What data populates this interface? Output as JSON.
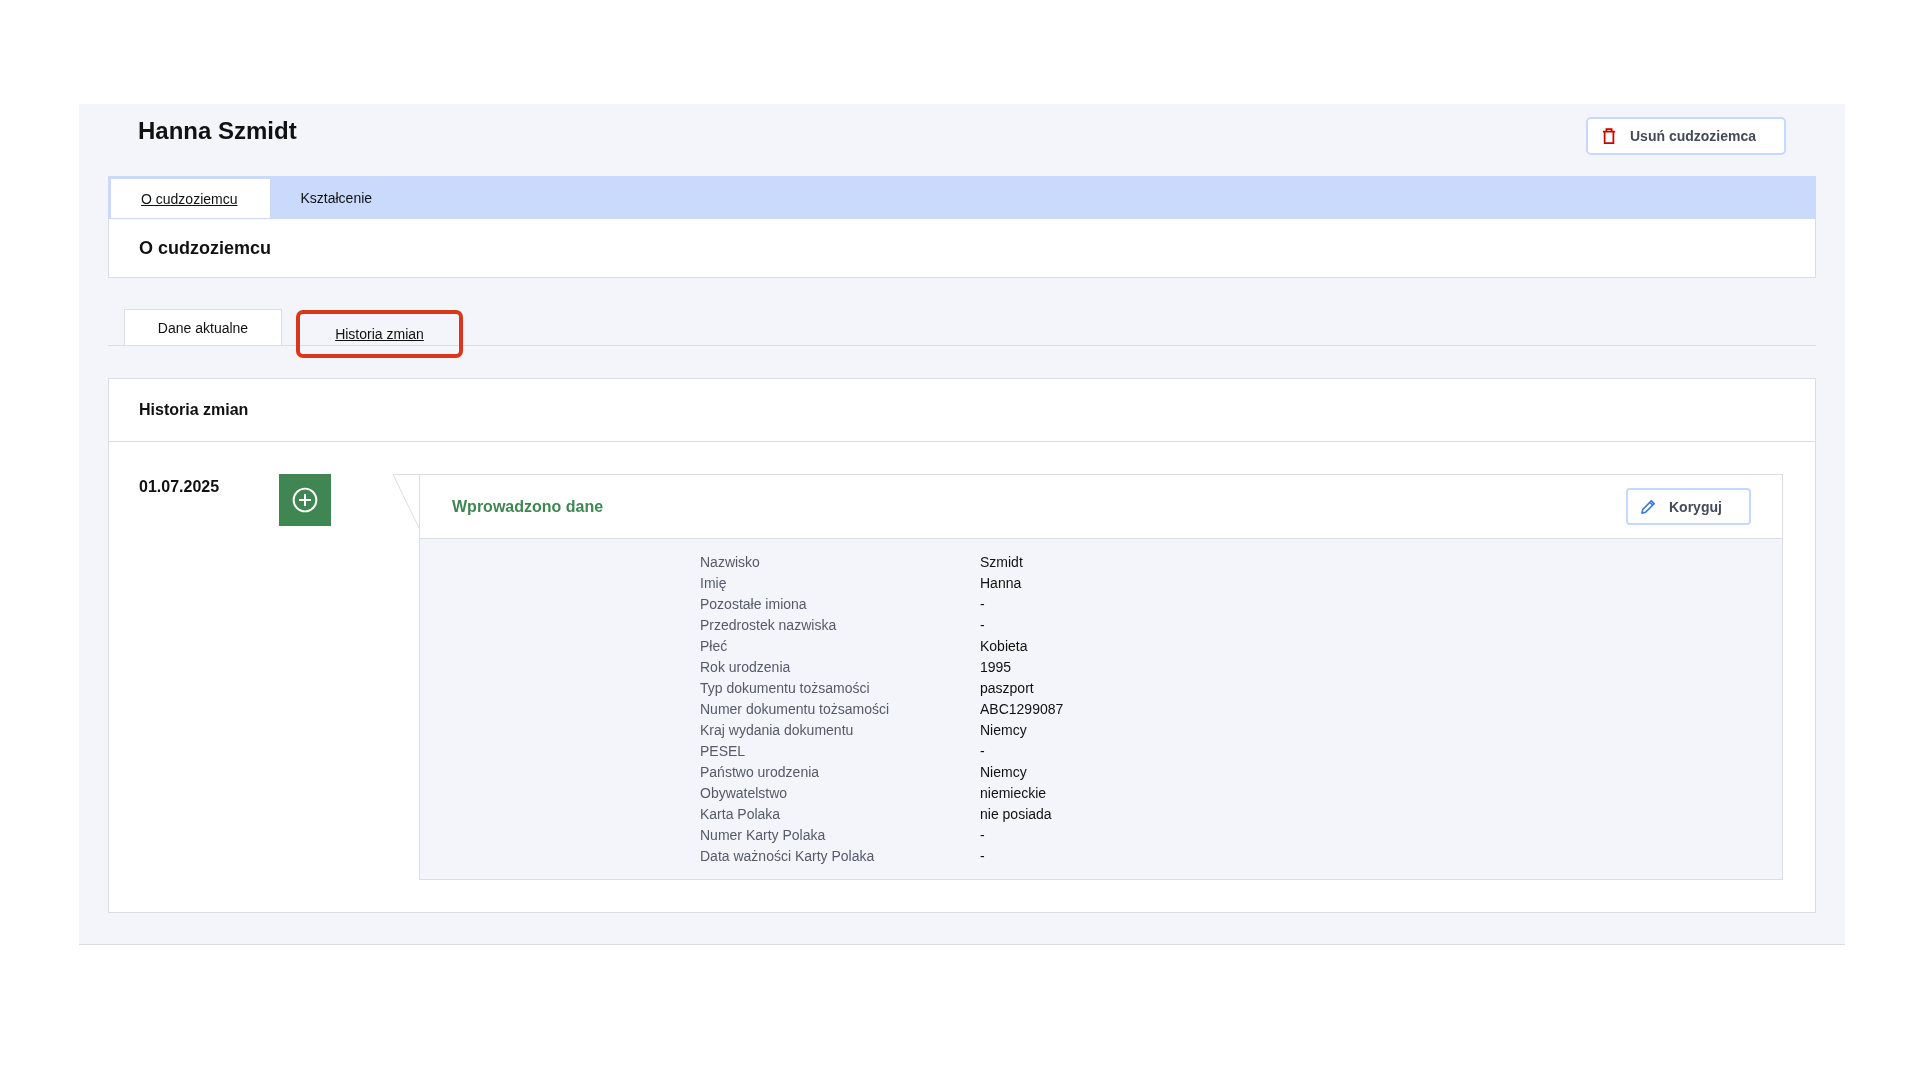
{
  "header": {
    "title": "Hanna Szmidt",
    "delete_button": "Usuń cudzoziemca"
  },
  "tabs": [
    {
      "label": "O cudzoziemcu",
      "selected": true
    },
    {
      "label": "Kształcenie",
      "selected": false
    }
  ],
  "section": {
    "title": "O cudzoziemcu"
  },
  "sub_tabs": [
    {
      "label": "Dane aktualne",
      "selected": false,
      "highlighted": false
    },
    {
      "label": "Historia zmian",
      "selected": true,
      "highlighted": true
    }
  ],
  "history": {
    "title": "Historia zmian",
    "entries": [
      {
        "date": "01.07.2025",
        "kind": "added",
        "title": "Wprowadzono dane",
        "button": "Koryguj",
        "fields": [
          {
            "label": "Nazwisko",
            "value": "Szmidt"
          },
          {
            "label": "Imię",
            "value": "Hanna"
          },
          {
            "label": "Pozostałe imiona",
            "value": "-"
          },
          {
            "label": "Przedrostek nazwiska",
            "value": "-"
          },
          {
            "label": "Płeć",
            "value": "Kobieta"
          },
          {
            "label": "Rok urodzenia",
            "value": "1995"
          },
          {
            "label": "Typ dokumentu tożsamości",
            "value": "paszport"
          },
          {
            "label": "Numer dokumentu tożsamości",
            "value": "ABC1299087"
          },
          {
            "label": "Kraj wydania dokumentu",
            "value": "Niemcy"
          },
          {
            "label": "PESEL",
            "value": "-"
          },
          {
            "label": "Państwo urodzenia",
            "value": "Niemcy"
          },
          {
            "label": "Obywatelstwo",
            "value": "niemieckie"
          },
          {
            "label": "Karta Polaka",
            "value": "nie posiada"
          },
          {
            "label": "Numer Karty Polaka",
            "value": "-"
          },
          {
            "label": "Data ważności Karty Polaka",
            "value": "-"
          }
        ]
      }
    ]
  }
}
